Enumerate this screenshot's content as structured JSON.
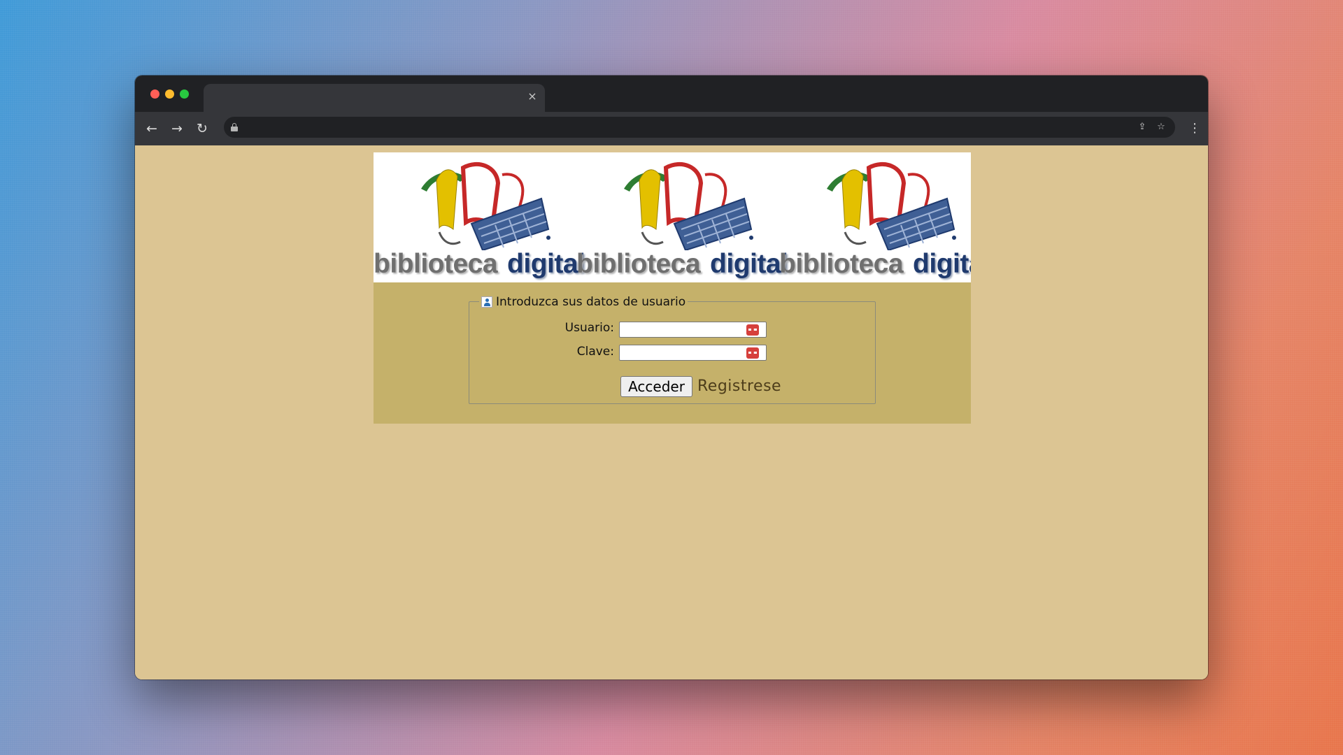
{
  "browser": {
    "tab_title": "",
    "tab_close_icon": "×",
    "url": "",
    "back_icon": "←",
    "forward_icon": "→",
    "reload_icon": "↻",
    "share_icon": "⇪",
    "star_icon": "☆",
    "menu_icon": "⋮"
  },
  "banner": {
    "logos": [
      {
        "word1": "biblioteca",
        "word2": "digital"
      },
      {
        "word1": "biblioteca",
        "word2": "digital"
      },
      {
        "word1": "biblioteca",
        "word2": "digital"
      }
    ],
    "colors": {
      "green": "#2e7d32",
      "yellow": "#e3c000",
      "red": "#c62828",
      "blue": "#1f3a6e"
    }
  },
  "login": {
    "legend": "Introduzca sus datos de usuario",
    "username_label": "Usuario:",
    "username_value": "",
    "password_label": "Clave:",
    "password_value": "",
    "submit_label": "Acceder",
    "register_label": "Registrese"
  },
  "colors": {
    "page_background": "#dcc593",
    "panel_background": "#c5b16a",
    "register_link": "#4d3d1a"
  }
}
